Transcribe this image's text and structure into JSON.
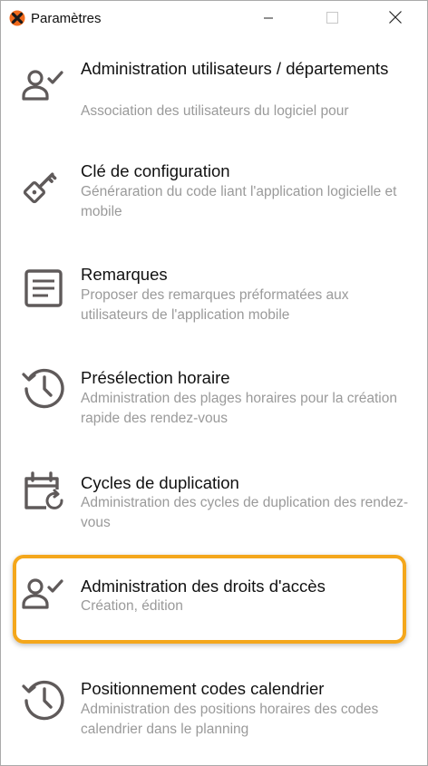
{
  "window": {
    "title": "Paramètres",
    "app_icon": "app-logo-icon",
    "controls": [
      "minimize",
      "maximize",
      "close"
    ]
  },
  "items": [
    {
      "icon": "user-check-icon",
      "label": "Administration utilisateurs / départements",
      "desc": "Association des utilisateurs du logiciel pour"
    },
    {
      "icon": "key-icon",
      "label": "Clé de configuration",
      "desc": "Généraration du code liant l'application logicielle et mobile"
    },
    {
      "icon": "note-icon",
      "label": "Remarques",
      "desc": "Proposer des remarques préformatées aux utilisateurs de l'application mobile"
    },
    {
      "icon": "history-clock-icon",
      "label": "Présélection horaire",
      "desc": "Administration des plages horaires pour la création rapide des rendez-vous"
    },
    {
      "icon": "calendar-sync-icon",
      "label": "Cycles de duplication",
      "desc": "Administration des cycles de duplication des rendez-vous"
    },
    {
      "icon": "user-check-icon",
      "label": "Administration des droits d'accès",
      "desc": "Création, édition",
      "highlighted": true,
      "highlight_color": "#f4a71c"
    },
    {
      "icon": "history-clock-icon",
      "label": "Positionnement codes calendrier",
      "desc": "Administration des positions horaires des codes calendrier dans le planning"
    }
  ],
  "colors": {
    "icon": "#5f5a5a",
    "label": "#111111",
    "desc": "#9a9a9a",
    "highlight": "#f4a71c"
  }
}
